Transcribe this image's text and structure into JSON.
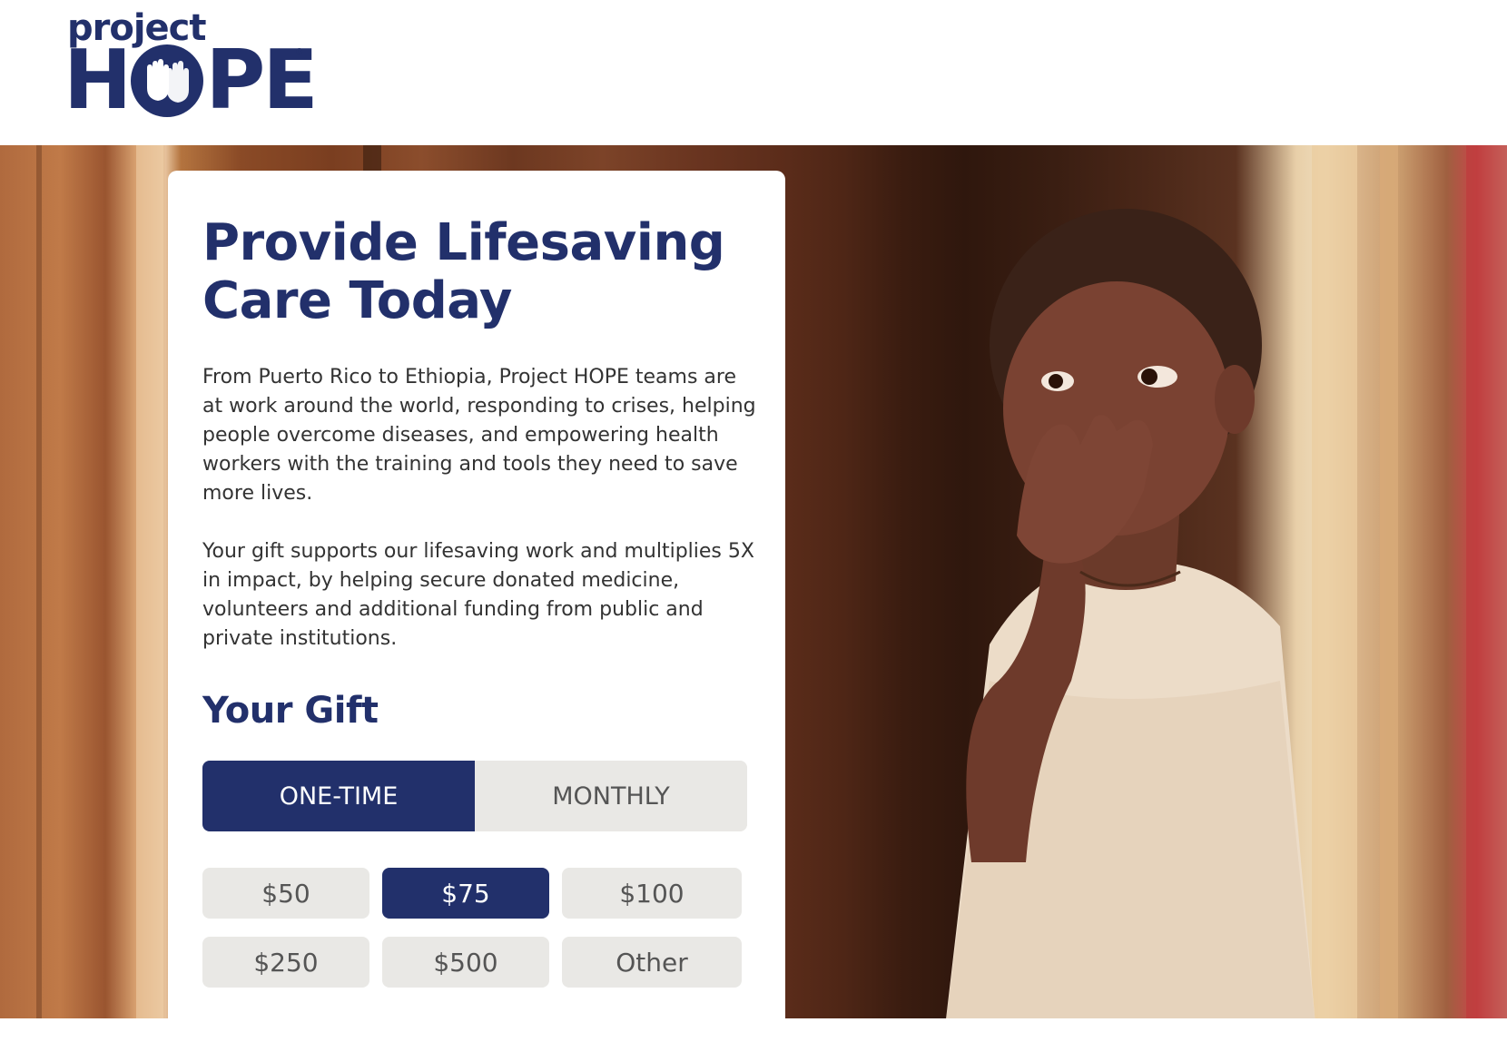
{
  "header": {
    "logo_small": "project",
    "logo_big_h": "H",
    "logo_big_pe": "PE",
    "logo_reg": "®"
  },
  "card": {
    "headline": "Provide Lifesaving Care Today",
    "paragraph1": "From Puerto Rico to Ethiopia, Project HOPE teams are at work around the world, responding to crises, helping people overcome diseases, and empowering health workers with the training and tools they need to save more lives.",
    "paragraph2": "Your gift supports our lifesaving work and multiplies 5X in impact, by helping secure donated medicine, volunteers and additional funding from public and private institutions.",
    "gift_heading": "Your Gift",
    "frequency": {
      "one_time": "ONE-TIME",
      "monthly": "MONTHLY",
      "selected": "ONE-TIME"
    },
    "amounts": [
      "$50",
      "$75",
      "$100",
      "$250",
      "$500",
      "Other"
    ],
    "selected_amount": "$75"
  },
  "colors": {
    "brand": "#22306b",
    "button_bg": "#e9e8e5",
    "text": "#333333"
  }
}
